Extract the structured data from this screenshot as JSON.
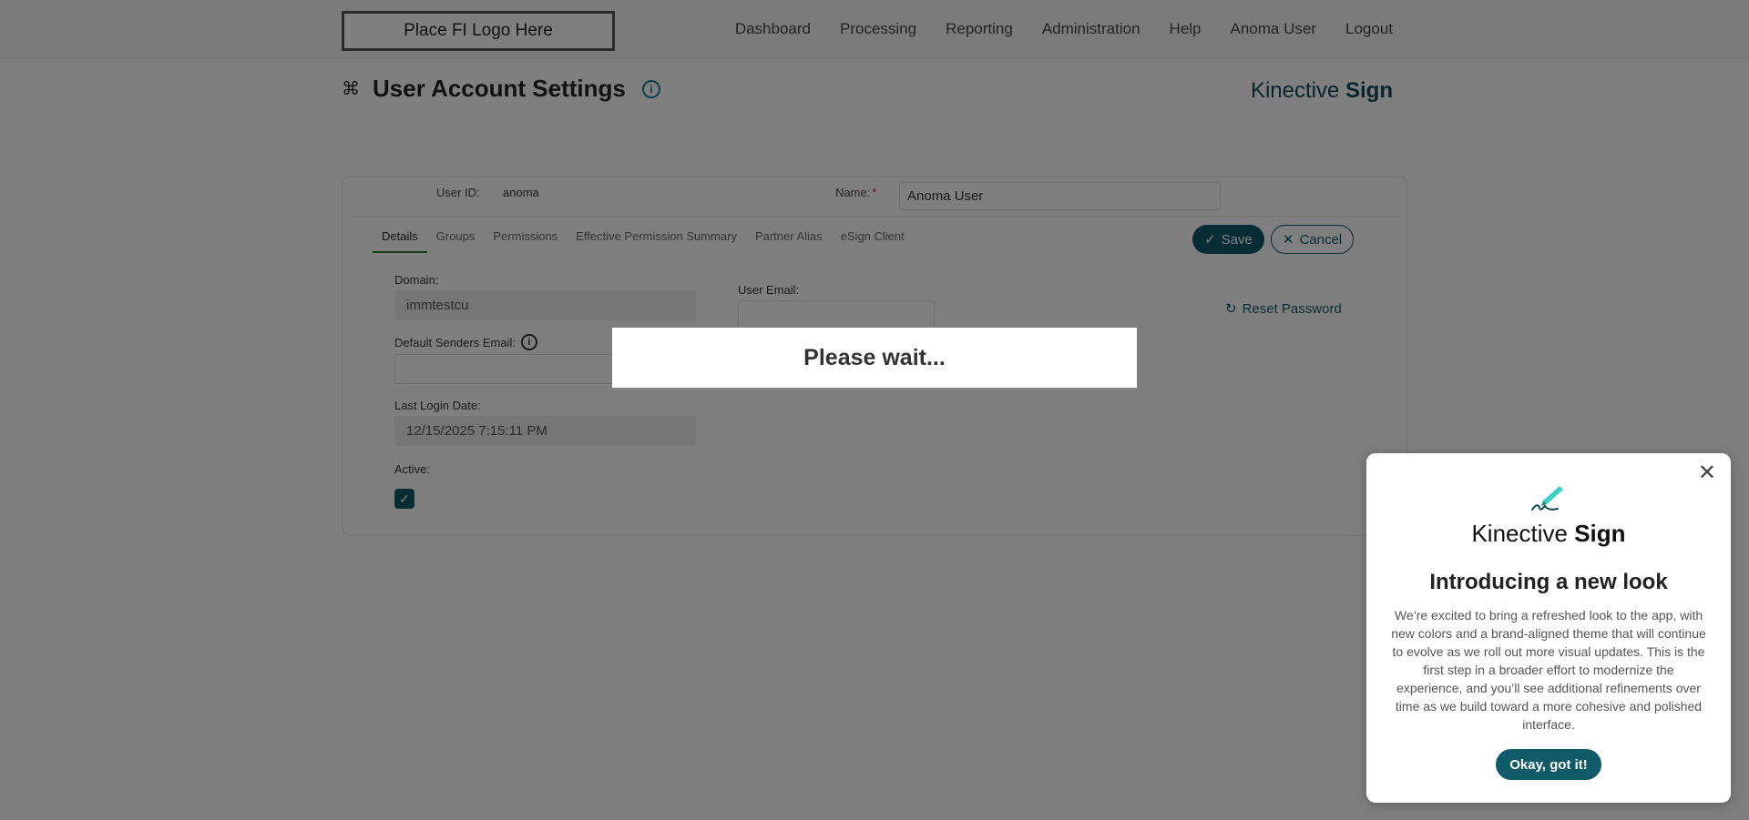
{
  "header": {
    "logo_text": "Place FI Logo Here",
    "nav": [
      "Dashboard",
      "Processing",
      "Reporting",
      "Administration",
      "Help",
      "Anoma User",
      "Logout"
    ]
  },
  "page": {
    "title": "User Account Settings",
    "title_icon": "command-icon",
    "brand_light": "Kinective",
    "brand_bold": "Sign"
  },
  "user": {
    "user_id_label": "User ID:",
    "user_id_value": "anoma",
    "name_label": "Name:",
    "name_required_mark": "*",
    "name_value": "Anoma User"
  },
  "tabs": [
    "Details",
    "Groups",
    "Permissions",
    "Effective Permission Summary",
    "Partner Alias",
    "eSign Client"
  ],
  "active_tab": "Details",
  "actions": {
    "save_label": "Save",
    "cancel_label": "Cancel",
    "reset_password_label": "Reset Password"
  },
  "fields": {
    "domain_label": "Domain:",
    "domain_value": "immtestcu",
    "user_email_label": "User Email:",
    "user_email_value": "",
    "default_senders_email_label": "Default Senders Email:",
    "default_senders_email_value": "",
    "last_login_label": "Last Login Date:",
    "last_login_value": "12/15/2025 7:15:11 PM",
    "active_label": "Active:",
    "active_checked": true
  },
  "loading": {
    "text": "Please wait..."
  },
  "popup": {
    "brand_light": "Kinective",
    "brand_bold": "Sign",
    "heading": "Introducing a new look",
    "body": "We’re excited to bring a refreshed look to the app, with new colors and a brand-aligned theme that will continue to evolve as we roll out more visual updates. This is the first step in a broader effort to modernize the experience, and you’ll see additional refinements over time as we build toward a more cohesive and polished interface.",
    "button_label": "Okay, got it!"
  },
  "colors": {
    "brand_teal": "#0e5a68",
    "accent_green": "#2e7d32",
    "required_red": "#c0392b"
  }
}
